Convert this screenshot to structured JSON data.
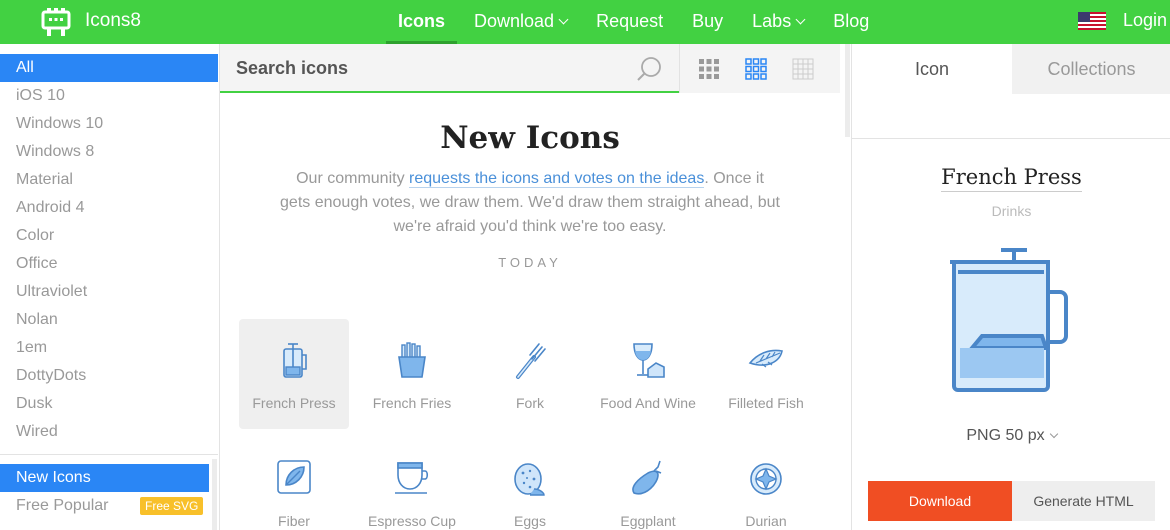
{
  "header": {
    "brand": "Icons8",
    "nav": [
      {
        "label": "Icons",
        "active": true,
        "dropdown": false
      },
      {
        "label": "Download",
        "active": false,
        "dropdown": true
      },
      {
        "label": "Request",
        "active": false,
        "dropdown": false
      },
      {
        "label": "Buy",
        "active": false,
        "dropdown": false
      },
      {
        "label": "Labs",
        "active": false,
        "dropdown": true
      },
      {
        "label": "Blog",
        "active": false,
        "dropdown": false
      }
    ],
    "login": "Login",
    "colors": {
      "bar": "#42d142",
      "active_underline": "#2ea12e"
    }
  },
  "sidebar": {
    "styles": [
      {
        "label": "All",
        "active": true
      },
      {
        "label": "iOS 10"
      },
      {
        "label": "Windows 10"
      },
      {
        "label": "Windows 8"
      },
      {
        "label": "Material"
      },
      {
        "label": "Android 4"
      },
      {
        "label": "Color"
      },
      {
        "label": "Office"
      },
      {
        "label": "Ultraviolet"
      },
      {
        "label": "Nolan"
      },
      {
        "label": "1em"
      },
      {
        "label": "DottyDots"
      },
      {
        "label": "Dusk"
      },
      {
        "label": "Wired"
      }
    ],
    "sections": [
      {
        "label": "New Icons",
        "active": true
      },
      {
        "label": "Free Popular",
        "badge": "Free SVG"
      }
    ],
    "active_color": "#2a86f5"
  },
  "search": {
    "placeholder": "Search icons"
  },
  "main": {
    "title": "New Icons",
    "intro_before": "Our community ",
    "intro_link": "requests the icons and votes on the ideas",
    "intro_after": ". Once it gets enough votes, we draw them. We'd draw them straight ahead, but we're afraid you'd think we're too easy.",
    "today": "TODAY",
    "icons": [
      {
        "name": "French Press",
        "glyph": "french-press-icon",
        "selected": true
      },
      {
        "name": "French Fries",
        "glyph": "french-fries-icon"
      },
      {
        "name": "Fork",
        "glyph": "fork-icon"
      },
      {
        "name": "Food And Wine",
        "glyph": "food-and-wine-icon"
      },
      {
        "name": "Filleted Fish",
        "glyph": "filleted-fish-icon"
      },
      {
        "name": "Fiber",
        "glyph": "fiber-icon"
      },
      {
        "name": "Espresso Cup",
        "glyph": "espresso-cup-icon"
      },
      {
        "name": "Eggs",
        "glyph": "eggs-icon"
      },
      {
        "name": "Eggplant",
        "glyph": "eggplant-icon"
      },
      {
        "name": "Durian",
        "glyph": "durian-icon"
      }
    ]
  },
  "panel": {
    "tabs": [
      {
        "label": "Icon",
        "active": true
      },
      {
        "label": "Collections",
        "active": false
      }
    ],
    "icon_name": "French Press",
    "icon_category": "Drinks",
    "format": "PNG 50 px",
    "download": "Download",
    "generate": "Generate HTML",
    "colors": {
      "download": "#f04e23",
      "icon_stroke": "#4a86c8",
      "icon_fill": "#cfe5fa"
    }
  }
}
